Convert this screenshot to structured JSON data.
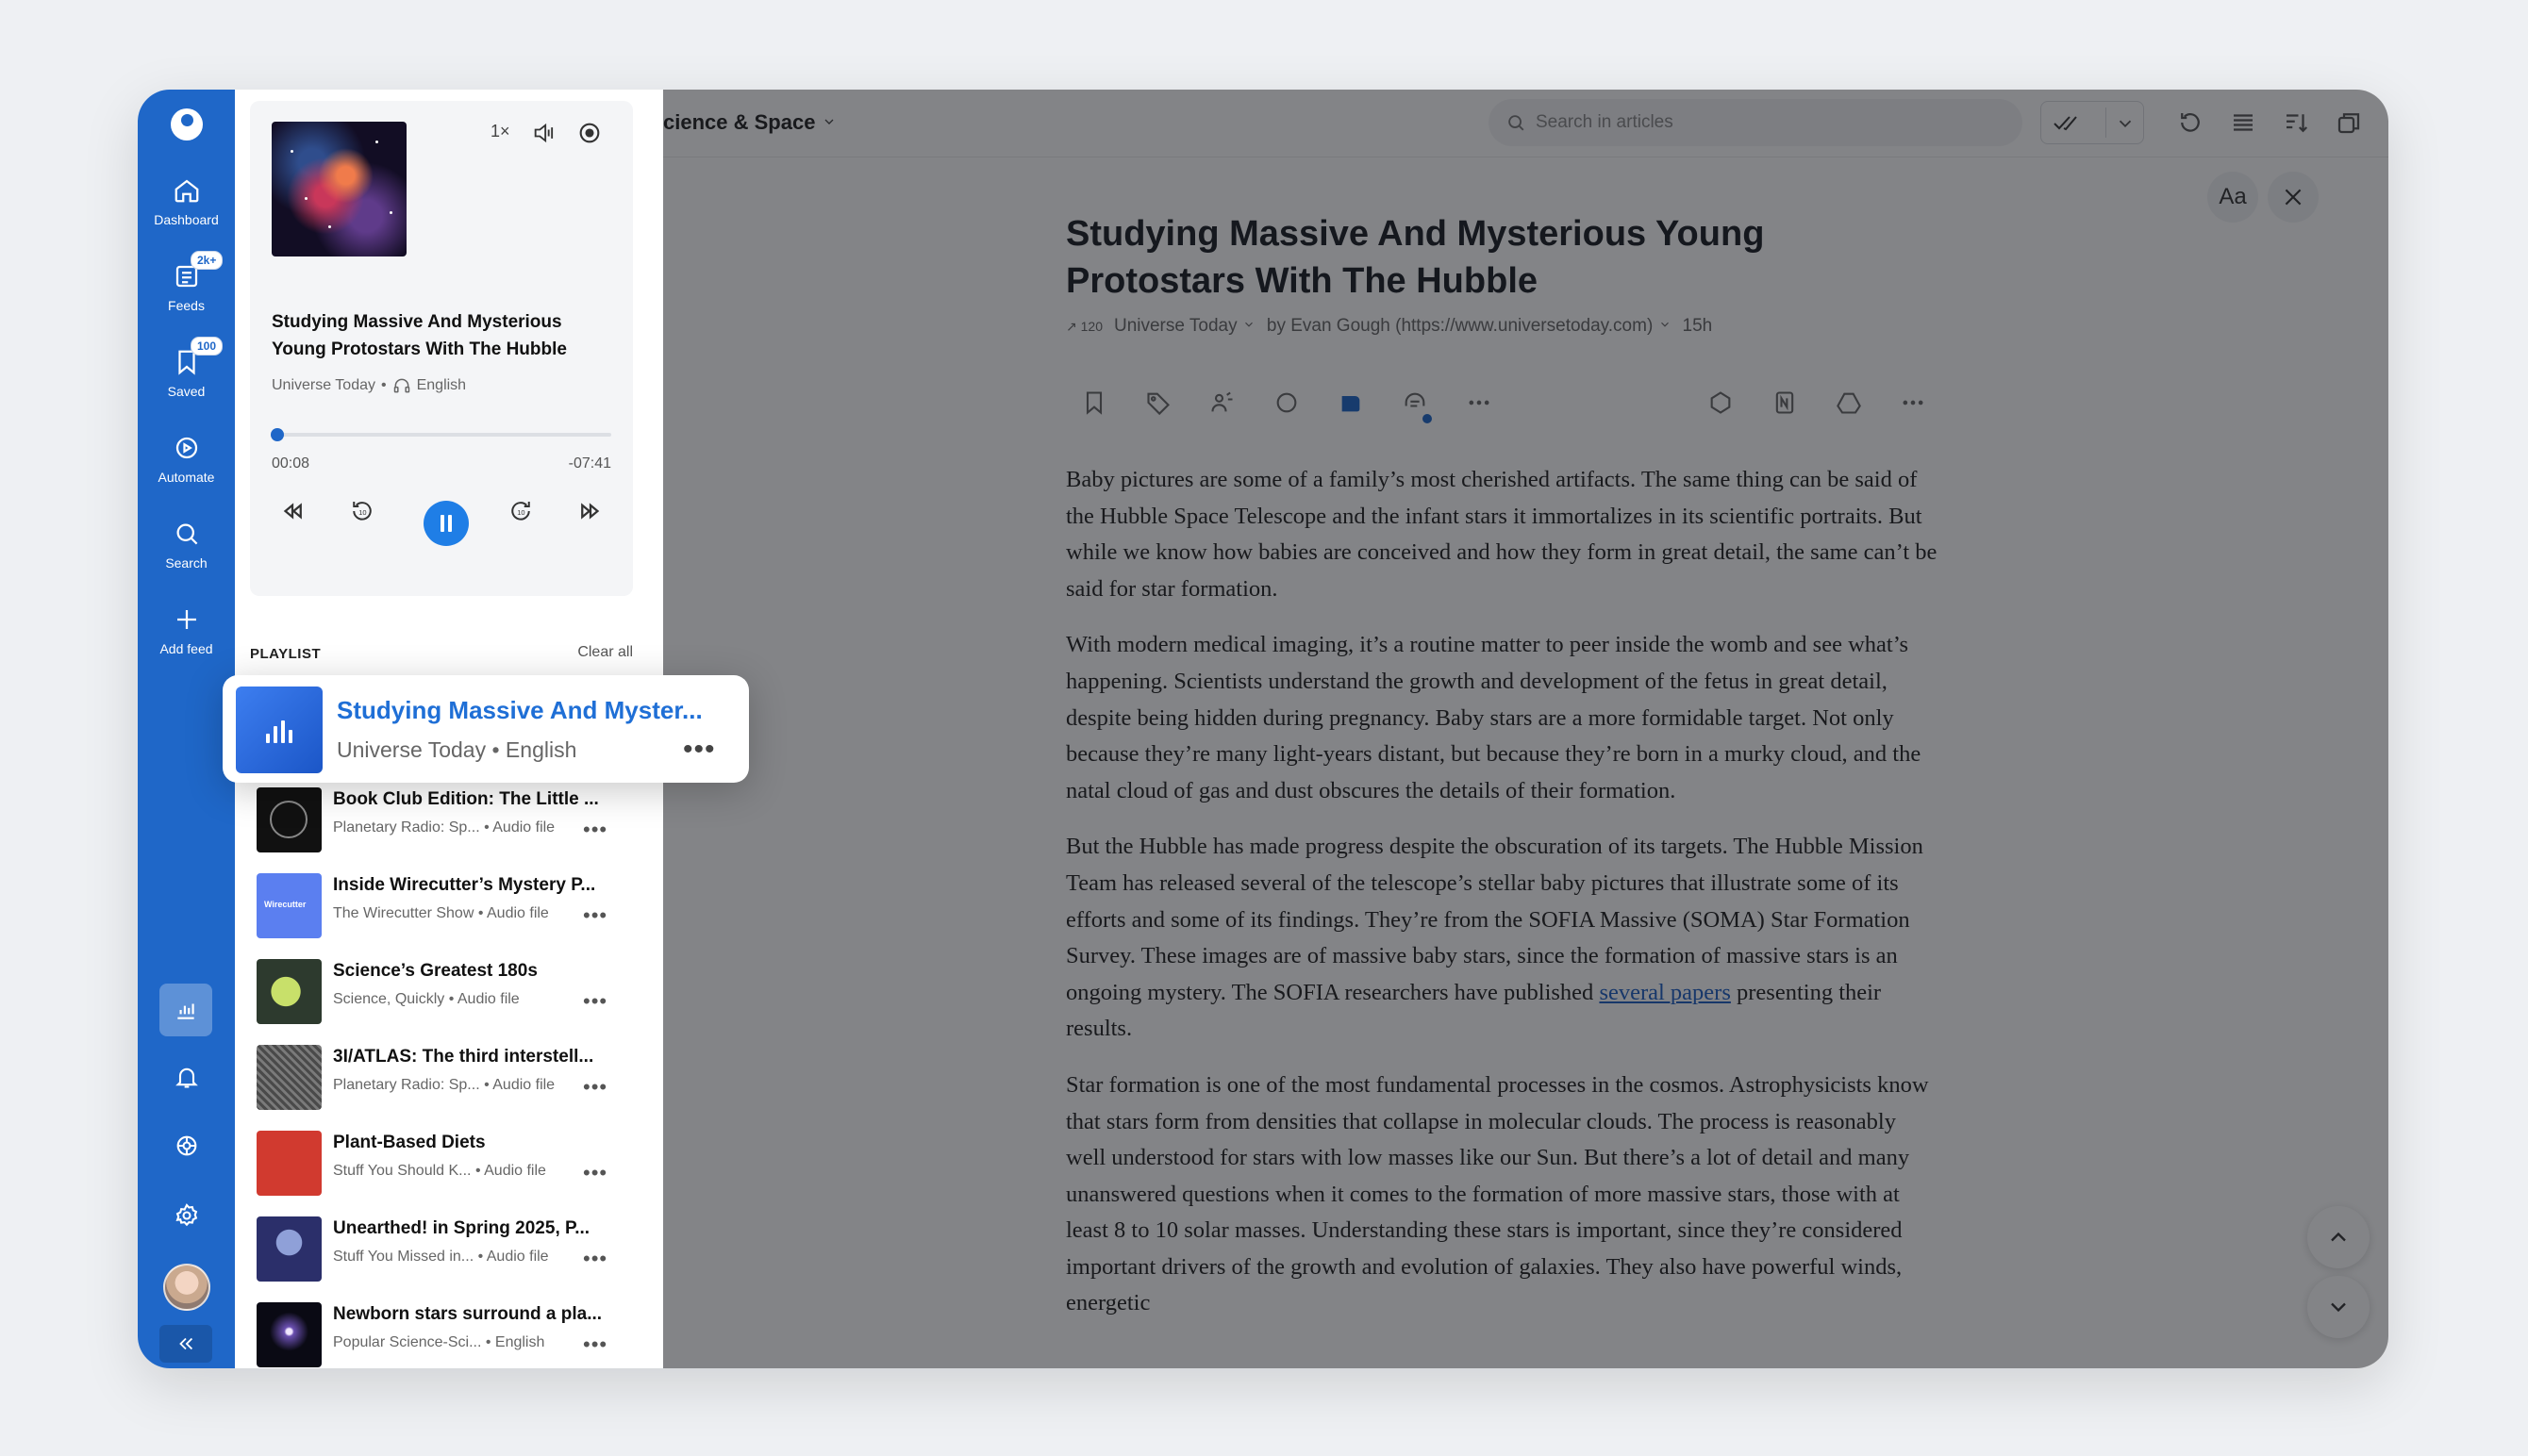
{
  "rail": {
    "items": [
      {
        "label": "Dashboard",
        "icon": "home-icon"
      },
      {
        "label": "Feeds",
        "icon": "feeds-icon",
        "badge": "2k+"
      },
      {
        "label": "Saved",
        "icon": "bookmark-icon",
        "badge": "100"
      },
      {
        "label": "Automate",
        "icon": "automate-icon"
      },
      {
        "label": "Search",
        "icon": "search-icon"
      },
      {
        "label": "Add feed",
        "icon": "plus-icon"
      }
    ],
    "bottom_icons": [
      "audio-bars-icon",
      "bell-icon",
      "integrations-icon",
      "gear-icon",
      "avatar",
      "collapse-icon"
    ]
  },
  "player": {
    "speed": "1×",
    "title": "Studying Massive And Mysterious Young Protostars With The Hubble",
    "source": "Universe Today",
    "language": "English",
    "elapsed": "00:08",
    "remaining": "-07:41",
    "progress": 0.017,
    "playing": true
  },
  "playlist": {
    "heading": "PLAYLIST",
    "clear": "Clear all",
    "now_playing": {
      "title": "Studying Massive And Myster...",
      "source": "Universe Today • English",
      "more": "•••"
    },
    "items": [
      {
        "title": "Book Club Edition: The Little ...",
        "source": "Planetary Radio: Sp...",
        "type": "• Audio file",
        "thumb": "#111111"
      },
      {
        "title": "Inside Wirecutter’s Mystery P...",
        "source": "The Wirecutter Show",
        "type": "• Audio file",
        "thumb": "#5b7ff0",
        "thumb_text": "Wirecutter"
      },
      {
        "title": "Science’s Greatest 180s",
        "source": "Science, Quickly",
        "type": "• Audio file",
        "thumb": "#2d3a2e"
      },
      {
        "title": "3I/ATLAS: The third interstell...",
        "source": "Planetary Radio: Sp...",
        "type": "• Audio file",
        "thumb": "#5a5a5a"
      },
      {
        "title": "Plant-Based Diets",
        "source": "Stuff You Should K...",
        "type": "• Audio file",
        "thumb": "#d13a2f"
      },
      {
        "title": "Unearthed! in Spring 2025, P...",
        "source": "Stuff You Missed in...",
        "type": "• Audio file",
        "thumb": "#2b2f6a"
      },
      {
        "title": "Newborn stars surround a pla...",
        "source": "Popular Science-Sci...",
        "type": "• English",
        "thumb": "#0a0a14"
      }
    ],
    "more": "•••"
  },
  "topbar": {
    "crumb": "cience & Space",
    "search_placeholder": "Search in articles"
  },
  "reader": {
    "font_button": "Aa",
    "title": "Studying Massive And Mysterious Young Protostars With The Hubble",
    "trend": "120",
    "source": "Universe Today",
    "author": "by Evan Gough (https://www.universetoday.com)",
    "age": "15h",
    "paragraphs": [
      "Baby pictures are some of a family’s most cherished artifacts. The same thing can be said of the Hubble Space Telescope and the infant stars it immortalizes in its scientific portraits. But while we know how babies are conceived and how they form in great detail, the same can’t be said for star formation.",
      "With modern medical imaging, it’s a routine matter to peer inside the womb and see what’s happening. Scientists understand the growth and development of the fetus in great detail, despite being hidden during pregnancy. Baby stars are a more formidable target. Not only because they’re many light-years distant, but because they’re born in a murky cloud, and the natal cloud of gas and dust obscures the details of their formation.",
      "But the Hubble has made progress despite the obscuration of its targets. The Hubble Mission Team has released several of the telescope’s stellar baby pictures that illustrate some of its efforts and some of its findings. They’re from the SOFIA Massive (SOMA) Star Formation Survey. These images are of massive baby stars, since the formation of massive stars is an ongoing mystery. The SOFIA researchers have published",
      "Star formation is one of the most fundamental processes in the cosmos. Astrophysicists know that stars form from densities that collapse in molecular clouds. The process is reasonably well understood for stars with low masses like our Sun. But there’s a lot of detail and many unanswered questions when it comes to the formation of more massive stars, those with at least 8 to 10 solar masses. Understanding these stars is important, since they’re considered important drivers of the growth and evolution of galaxies. They also have powerful winds, energetic"
    ],
    "link_text": "several papers",
    "link_tail": " presenting their results."
  },
  "colors": {
    "accent": "#1f67c8",
    "overlay": "rgba(18,20,24,0.52)",
    "link": "#1e5fc2"
  }
}
